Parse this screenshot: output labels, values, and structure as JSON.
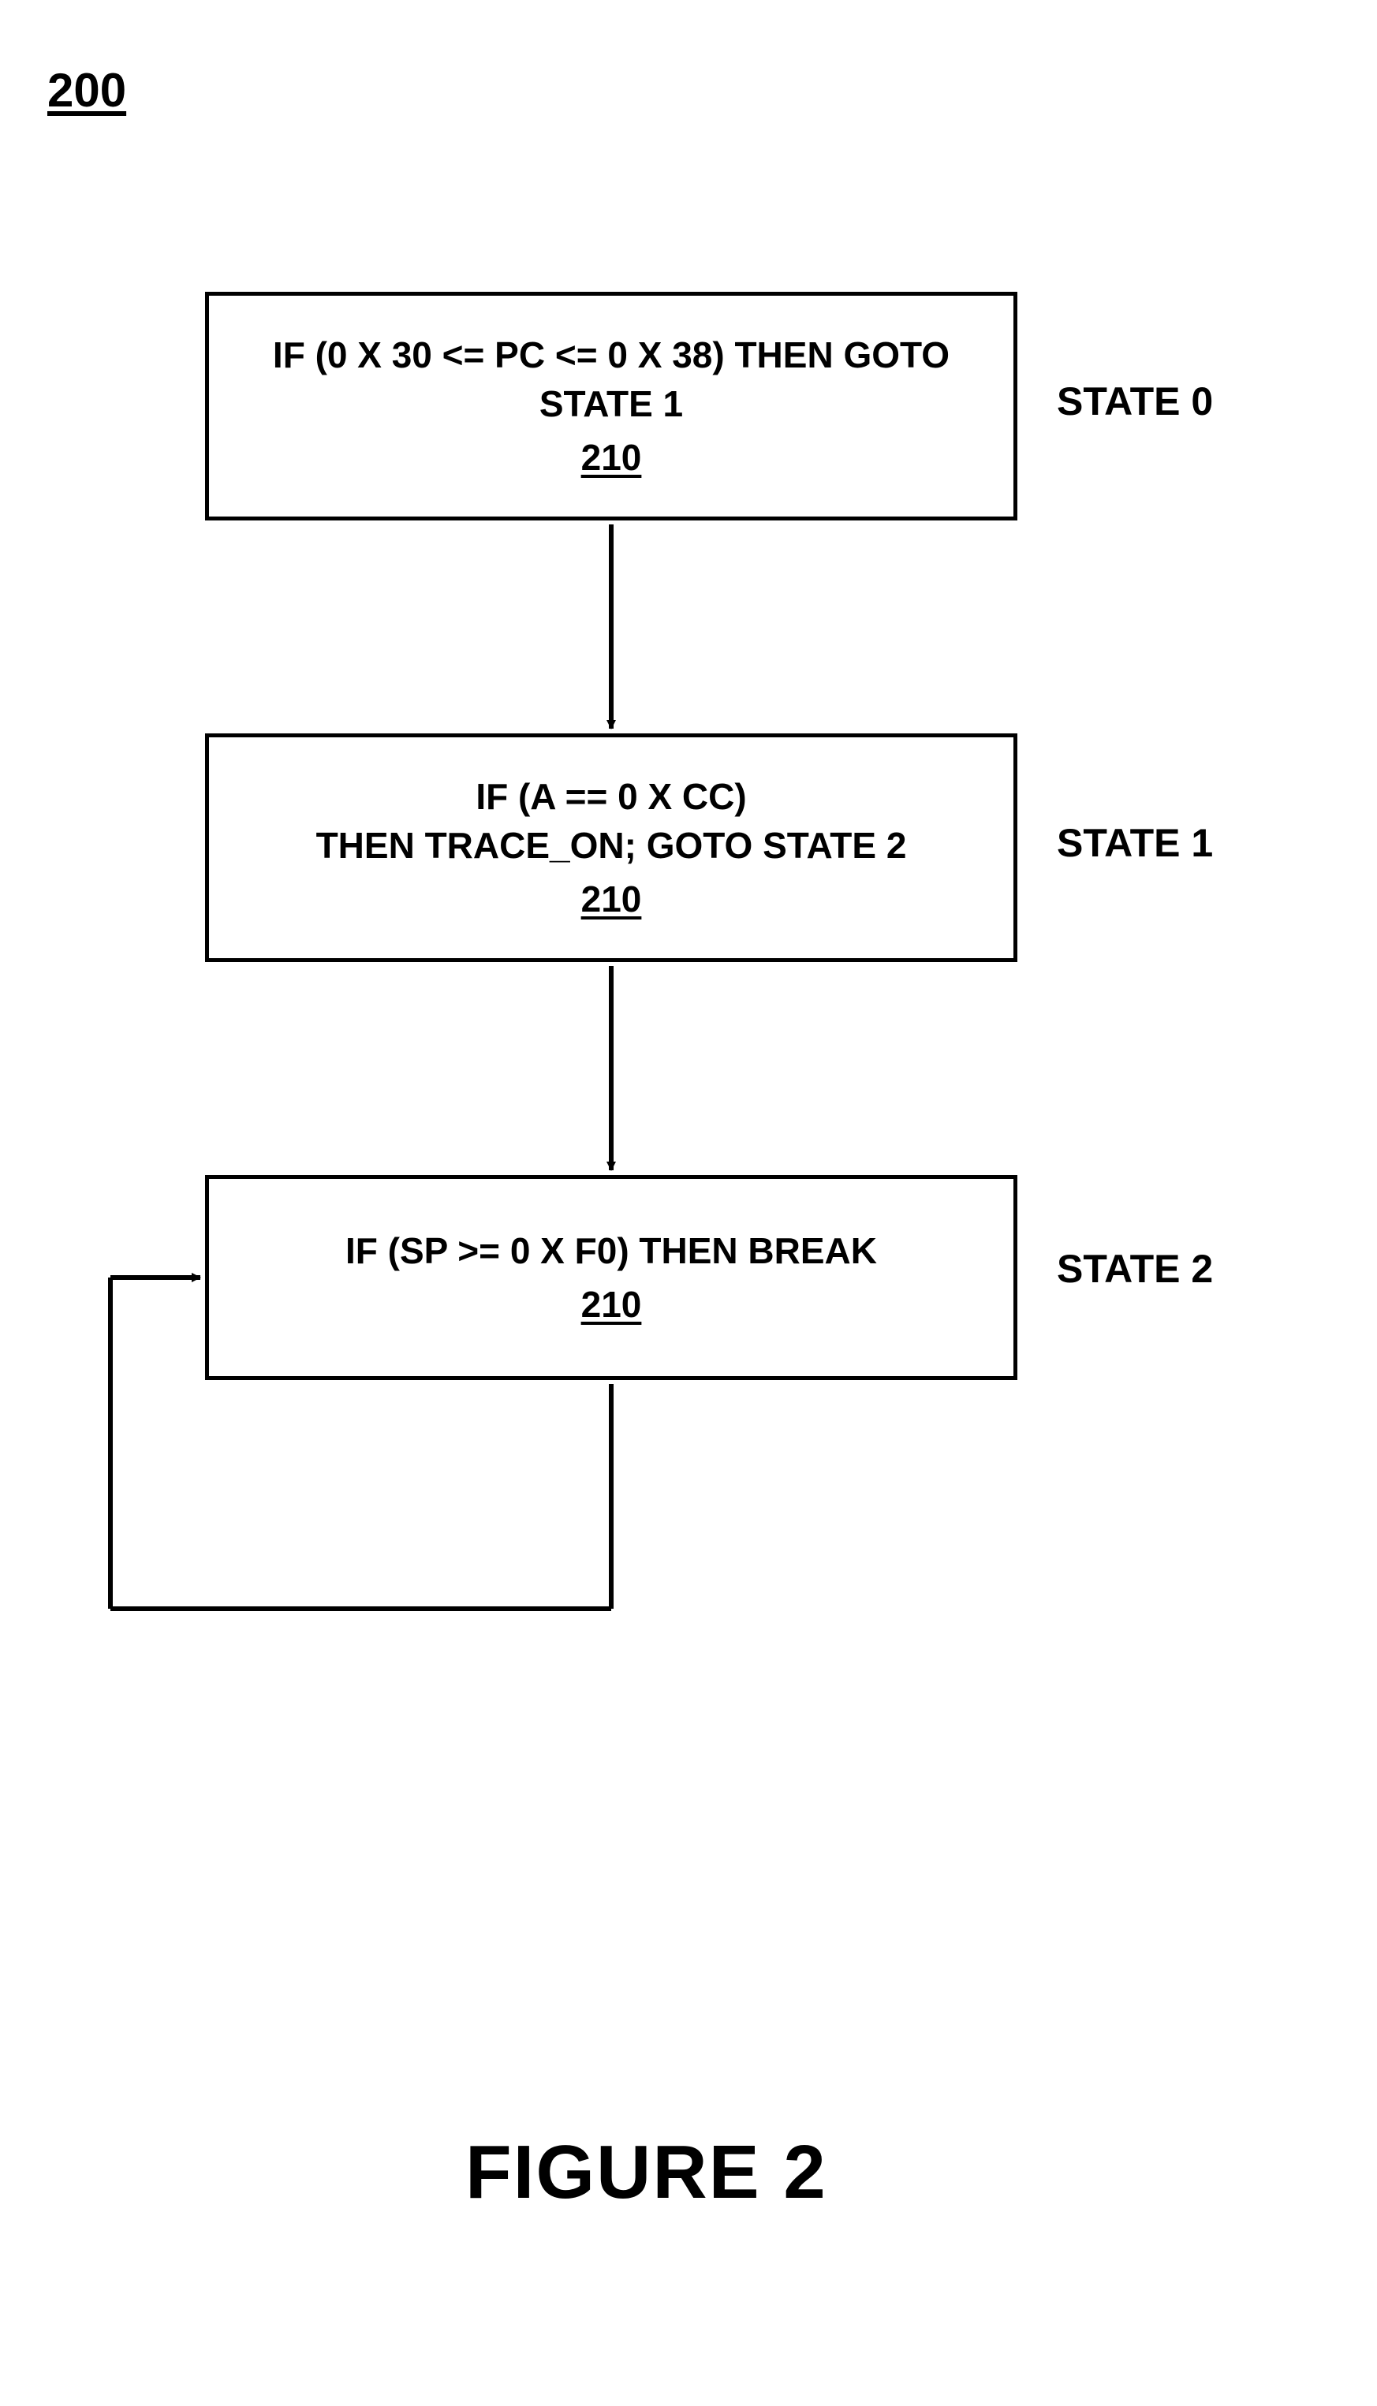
{
  "figure_number": "200",
  "states": [
    {
      "label": "STATE 0",
      "line1": "IF (0 X 30 <= PC <= 0 X 38) THEN GOTO",
      "line2": "STATE 1",
      "ref": "210"
    },
    {
      "label": "STATE 1",
      "line1": "IF (A == 0 X CC)",
      "line2": "THEN TRACE_ON; GOTO STATE 2",
      "ref": "210"
    },
    {
      "label": "STATE 2",
      "line1": "IF (SP >= 0 X F0) THEN BREAK",
      "line2": "",
      "ref": "210"
    }
  ],
  "caption": "FIGURE 2"
}
